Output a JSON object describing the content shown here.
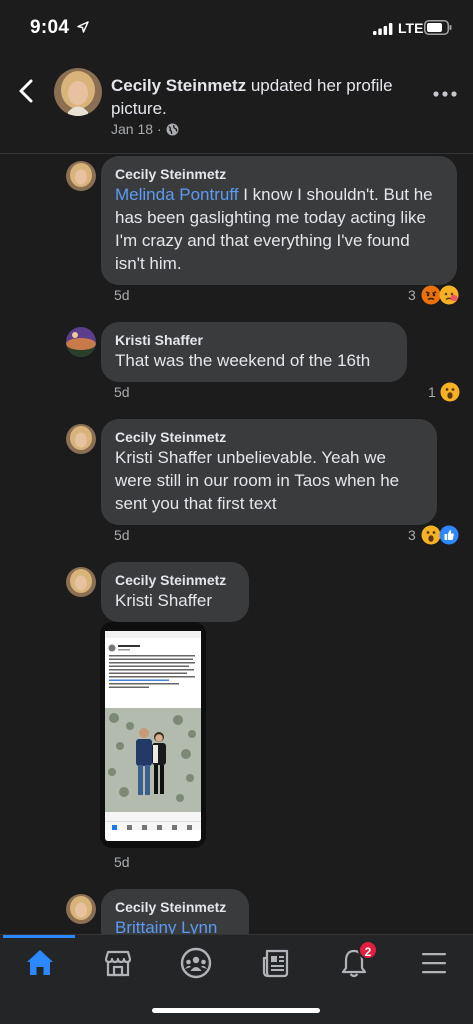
{
  "status_bar": {
    "time": "9:04",
    "network": "LTE"
  },
  "header": {
    "author": "Cecily Steinmetz",
    "action": " updated her profile picture.",
    "date": "Jan 18",
    "separator": "·"
  },
  "comments": [
    {
      "name": "Cecily Steinmetz",
      "mention": "Melinda Pontruff",
      "text": " I know I shouldn't. But he has been gaslighting me today acting like I'm crazy and that everything I've found isn't him.",
      "time": "5d",
      "reactions_count": "3",
      "reactions": [
        "angry-icon",
        "sad-icon"
      ]
    },
    {
      "name": "Kristi Shaffer",
      "mention": "",
      "text": "That was the weekend of the 16th",
      "time": "5d",
      "reactions_count": "1",
      "reactions": [
        "wow-icon"
      ]
    },
    {
      "name": "Cecily Steinmetz",
      "mention": "",
      "text": "Kristi Shaffer unbelievable. Yeah we were still in our room in Taos when he sent you that first text",
      "time": "5d",
      "reactions_count": "3",
      "reactions": [
        "wow-icon",
        "like-icon"
      ]
    },
    {
      "name": "Cecily Steinmetz",
      "mention": "",
      "text": "Kristi Shaffer",
      "time": "5d",
      "reactions_count": "",
      "reactions": []
    },
    {
      "name": "Cecily Steinmetz",
      "mention": "Brittainy Lynn",
      "text": "",
      "time": "",
      "reactions_count": "",
      "reactions": []
    }
  ],
  "bottom_nav": {
    "items": [
      "home-icon",
      "marketplace-icon",
      "groups-icon",
      "news-icon",
      "notifications-icon",
      "menu-icon"
    ],
    "notification_badge": "2"
  },
  "colors": {
    "background": "#1c1c1d",
    "bubble": "#3a3b3d",
    "accent": "#2d88ff",
    "mention": "#5b9bf3",
    "badge": "#e41e3f"
  }
}
